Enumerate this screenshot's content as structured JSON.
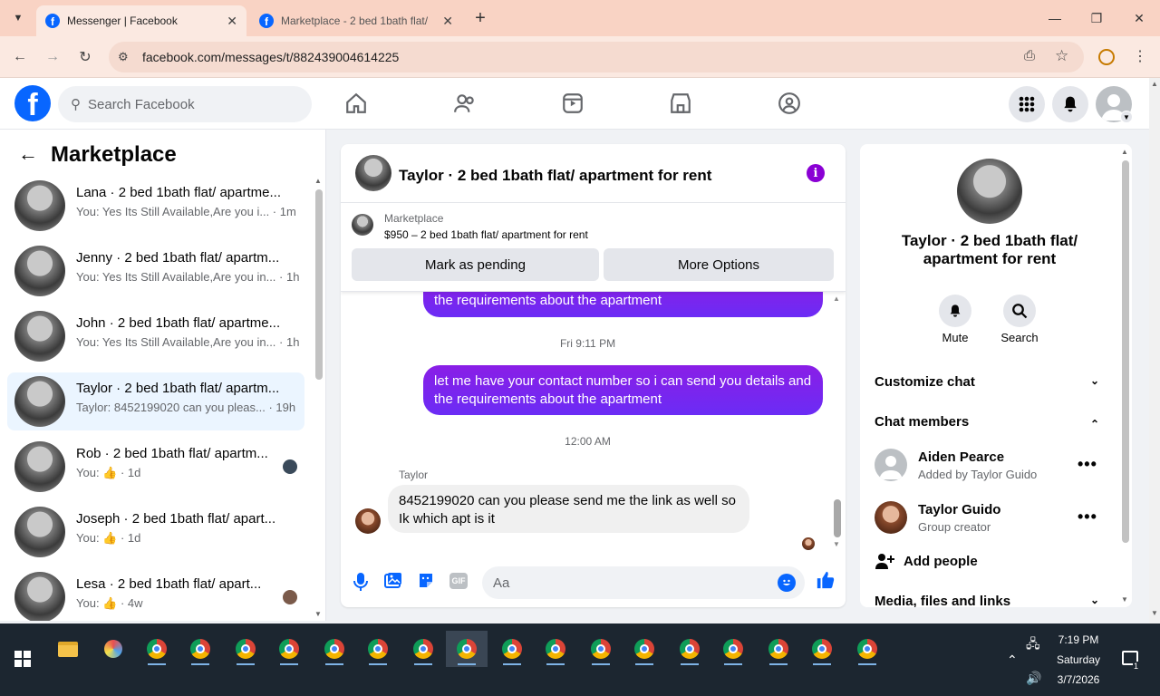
{
  "browser": {
    "tabs": [
      {
        "title": "Messenger | Facebook",
        "active": true
      },
      {
        "title": "Marketplace - 2 bed 1bath flat/",
        "active": false
      }
    ],
    "url": "facebook.com/messages/t/882439004614225"
  },
  "fb_header": {
    "logo": "f",
    "search_placeholder": "Search Facebook"
  },
  "left": {
    "title": "Marketplace",
    "conversations": [
      {
        "name": "Lana · 2 bed 1bath flat/ apartme...",
        "snippet": "You: Yes Its Still Available,Are you i... · 1m"
      },
      {
        "name": "Jenny · 2 bed 1bath flat/ apartm...",
        "snippet": "You: Yes Its Still Available,Are you in... · 1h"
      },
      {
        "name": "John · 2 bed 1bath flat/ apartme...",
        "snippet": "You: Yes Its Still Available,Are you in... · 1h"
      },
      {
        "name": "Taylor · 2 bed 1bath flat/ apartm...",
        "snippet": "Taylor: 8452199020 can you pleas... · 19h"
      },
      {
        "name": "Rob · 2 bed 1bath flat/ apartm...",
        "snippet": "You: 👍 · 1d"
      },
      {
        "name": "Joseph · 2 bed 1bath flat/ apart...",
        "snippet": "You: 👍 · 1d"
      },
      {
        "name": "Lesa · 2 bed 1bath flat/ apart...",
        "snippet": "You: 👍 · 4w"
      }
    ]
  },
  "chat": {
    "title": "Taylor · 2 bed 1bath flat/ apartment for rent",
    "marketplace_label": "Marketplace",
    "listing": "$950 – 2 bed 1bath flat/ apartment for rent",
    "mark_pending": "Mark as pending",
    "more_options": "More Options",
    "partial_msg": "the requirements about the apartment",
    "time1": "Fri 9:11 PM",
    "msg1": "let me have your contact number so i can send you details and the requirements about the apartment",
    "time2": "12:00 AM",
    "sender": "Taylor",
    "msg2": "8452199020 can you please send me the link as well so Ik which apt is it",
    "composer_placeholder": "Aa"
  },
  "right": {
    "title": "Taylor · 2 bed 1bath flat/ apartment for rent",
    "mute": "Mute",
    "search": "Search",
    "customize": "Customize chat",
    "members_header": "Chat members",
    "members": [
      {
        "name": "Aiden Pearce",
        "sub": "Added by Taylor Guido"
      },
      {
        "name": "Taylor Guido",
        "sub": "Group creator"
      }
    ],
    "add_people": "Add people",
    "media": "Media, files and links"
  },
  "taskbar": {
    "time": "7:19 PM",
    "day": "Saturday",
    "date": "3/7/2026",
    "notif_count": "1"
  },
  "colors": {
    "fb_blue": "#0866ff",
    "bubble_purple": "#7a27ee",
    "tab_strip": "#f9d3c4"
  }
}
